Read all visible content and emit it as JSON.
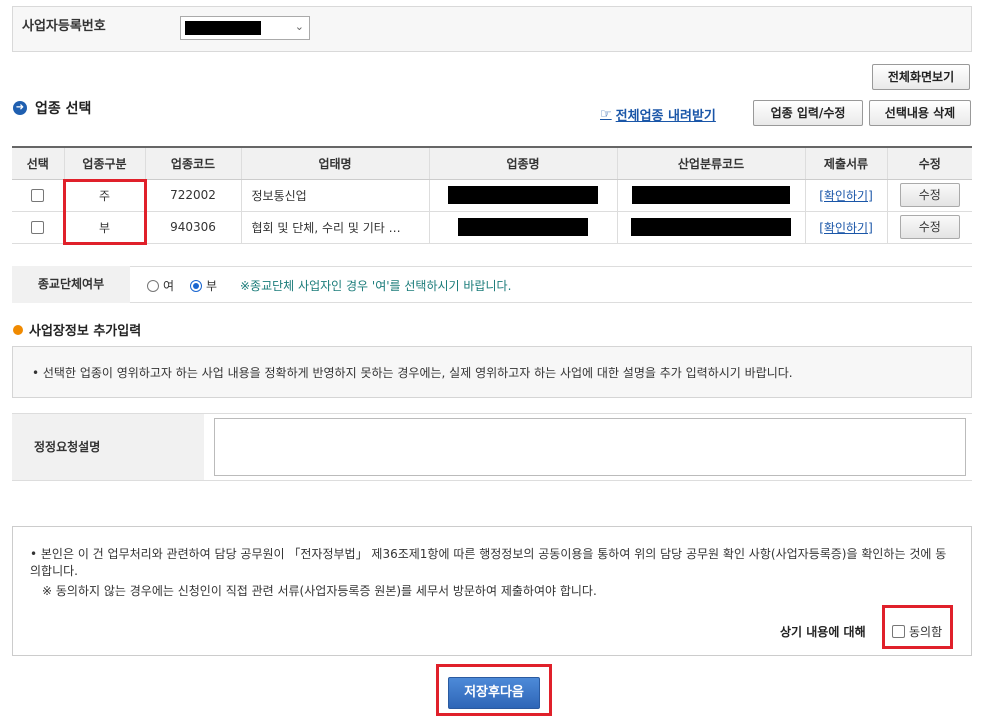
{
  "biz": {
    "label": "사업자등록번호",
    "select_chevron": "⌄"
  },
  "buttons": {
    "full_screen": "전체화면보기",
    "download_all": "전체업종 내려받기",
    "input_edit": "업종 입력/수정",
    "delete_selected": "선택내용 삭제",
    "save_next": "저장후다음"
  },
  "section": {
    "title": "업종 선택",
    "arrow": "➜"
  },
  "table": {
    "headers": [
      "선택",
      "업종구분",
      "업종코드",
      "업태명",
      "업종명",
      "산업분류코드",
      "제출서류",
      "수정"
    ],
    "rows": [
      {
        "type": "주",
        "code": "722002",
        "biz_status": "정보통신업",
        "doc_link": "[확인하기]",
        "edit": "수정"
      },
      {
        "type": "부",
        "code": "940306",
        "biz_status": "협회 및 단체, 수리 및 기타 …",
        "doc_link": "[확인하기]",
        "edit": "수정"
      }
    ]
  },
  "religion": {
    "label": "종교단체여부",
    "opt_yes": "여",
    "opt_no": "부",
    "selected": "부",
    "note": "※종교단체 사업자인 경우 '여'를 선택하시기 바랍니다."
  },
  "extra": {
    "title": "사업장정보 추가입력",
    "info": "• 선택한 업종이 영위하고자 하는 사업 내용을 정확하게 반영하지 못하는 경우에는, 실제 영위하고자 하는 사업에 대한 설명을 추가 입력하시기 바랍니다.",
    "request_label": "정정요청설명"
  },
  "agree": {
    "text1": "• 본인은 이 건 업무처리와 관련하여 담당 공무원이 「전자정부법」 제36조제1항에 따른 행정정보의 공동이용을 통하여 위의 담당 공무원 확인 사항(사업자등록증)을 확인하는 것에 동의합니다.",
    "text2": "※  동의하지 않는 경우에는 신청인이 직접 관련 서류(사업자등록증 원본)를 세무서 방문하여 제출하여야 합니다.",
    "question": "상기 내용에 대해",
    "checkbox_label": "동의함"
  }
}
